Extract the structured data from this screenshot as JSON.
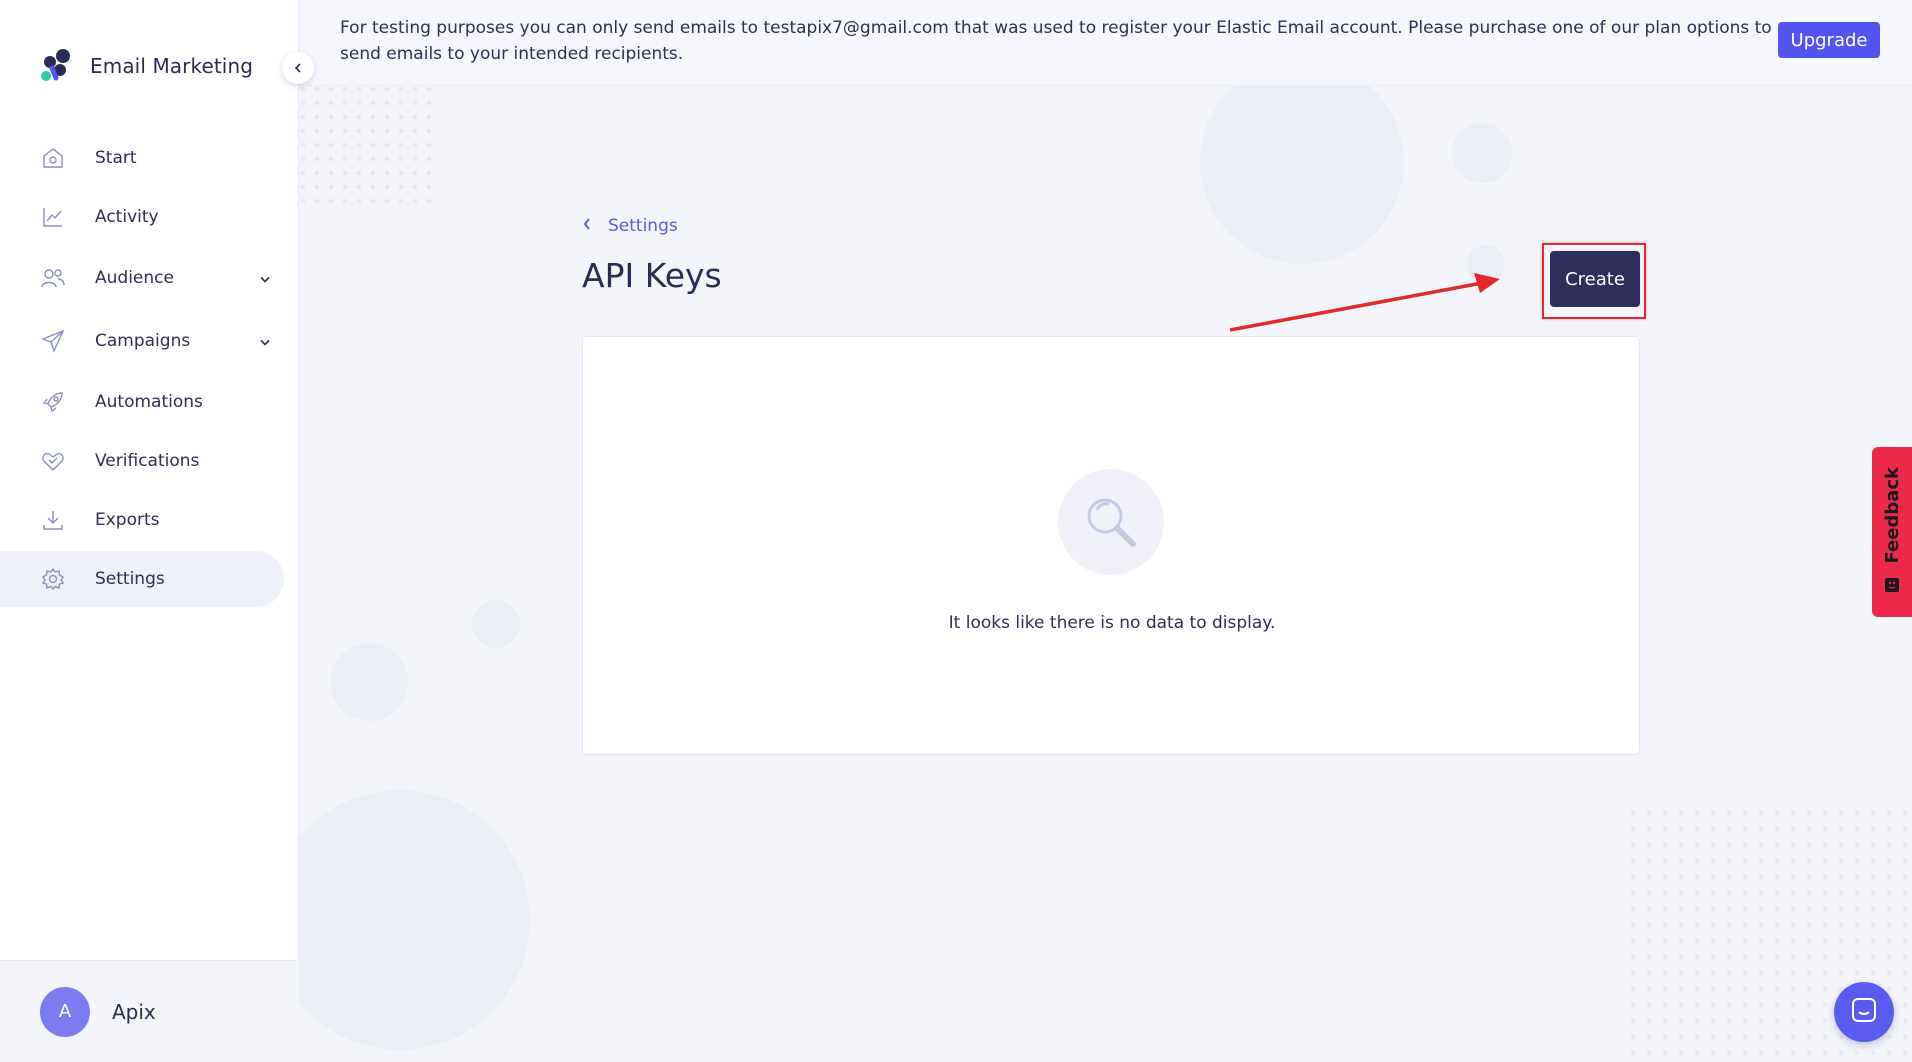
{
  "brand": {
    "title": "Email Marketing"
  },
  "nav": {
    "items": [
      {
        "label": "Start",
        "icon": "home-icon"
      },
      {
        "label": "Activity",
        "icon": "chart-icon"
      },
      {
        "label": "Audience",
        "icon": "users-icon"
      },
      {
        "label": "Campaigns",
        "icon": "paper-plane-icon"
      },
      {
        "label": "Automations",
        "icon": "rocket-icon"
      },
      {
        "label": "Verifications",
        "icon": "heart-badge-icon"
      },
      {
        "label": "Exports",
        "icon": "download-icon"
      },
      {
        "label": "Settings",
        "icon": "gear-icon"
      }
    ],
    "active": "Settings"
  },
  "user": {
    "initial": "A",
    "name": "Apix"
  },
  "banner": {
    "text": "For testing purposes you can only send emails to testapix7@gmail.com that was used to register your Elastic Email account. Please purchase one of our plan options to send emails to your intended recipients.",
    "upgrade_label": "Upgrade"
  },
  "page": {
    "breadcrumb": "Settings",
    "title": "API Keys",
    "create_label": "Create",
    "empty_text": "It looks like there is no data to display."
  },
  "feedback": {
    "label": "Feedback"
  },
  "colors": {
    "accent": "#5355f0",
    "create_button": "#2f2d5a",
    "annotation": "#e12a2a",
    "feedback": "#ed2a4a",
    "chat": "#5a5cf0"
  }
}
